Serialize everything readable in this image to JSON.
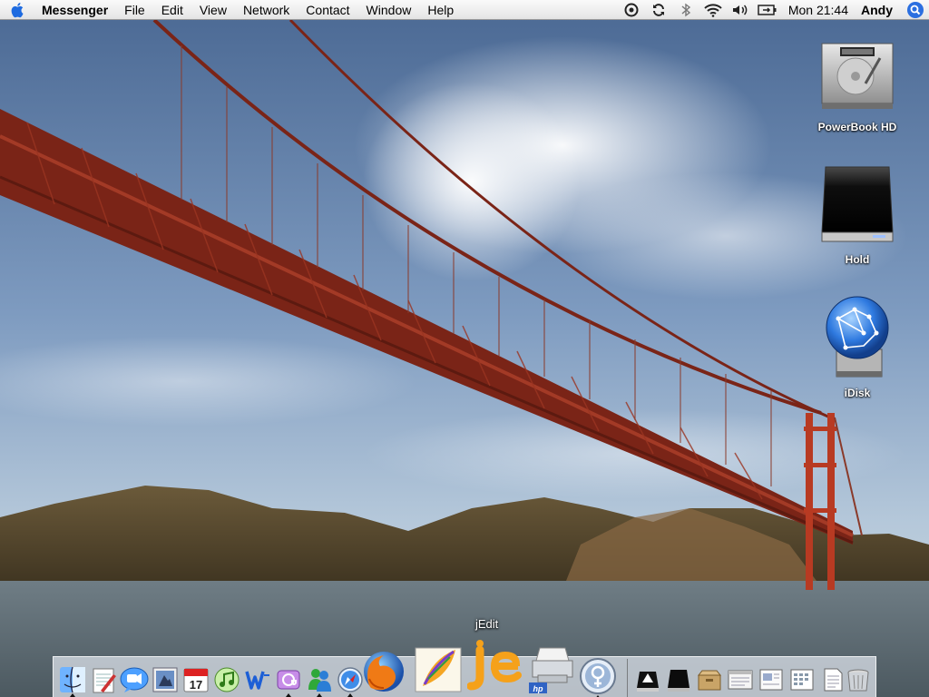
{
  "menubar": {
    "app_name": "Messenger",
    "menus": [
      "File",
      "Edit",
      "View",
      "Network",
      "Contact",
      "Window",
      "Help"
    ],
    "clock": "Mon 21:44",
    "user": "Andy",
    "status_icons": [
      "messenger-status-icon",
      "sync-icon",
      "bluetooth-icon",
      "wifi-icon",
      "volume-icon",
      "battery-icon"
    ]
  },
  "desktop_icons": [
    {
      "label": "PowerBook HD",
      "icon": "hard-drive-icon"
    },
    {
      "label": "Hold",
      "icon": "external-drive-icon"
    },
    {
      "label": "iDisk",
      "icon": "idisk-icon"
    }
  ],
  "dock": {
    "tooltip": "jEdit",
    "items": [
      "finder-icon",
      "textedit-icon",
      "ichat-icon",
      "preview-icon",
      "ical-icon",
      "itunes-icon",
      "word-icon",
      "entourage-icon",
      "msn-messenger-icon",
      "safari-icon",
      "firefox-icon",
      "feather-app-icon",
      "jedit-icon",
      "hp-printer-icon",
      "system-prefs-icon",
      "stack-drive-icon",
      "black-drive-icon",
      "box-folder-icon",
      "window-doc-icon",
      "doc-icon",
      "calendar-doc-icon",
      "text-doc-icon",
      "trash-icon"
    ],
    "calendar_day": "17"
  },
  "colors": {
    "bridge": "#8a2a1c",
    "sky": "#6f8fb5",
    "water": "#5e6b73"
  }
}
